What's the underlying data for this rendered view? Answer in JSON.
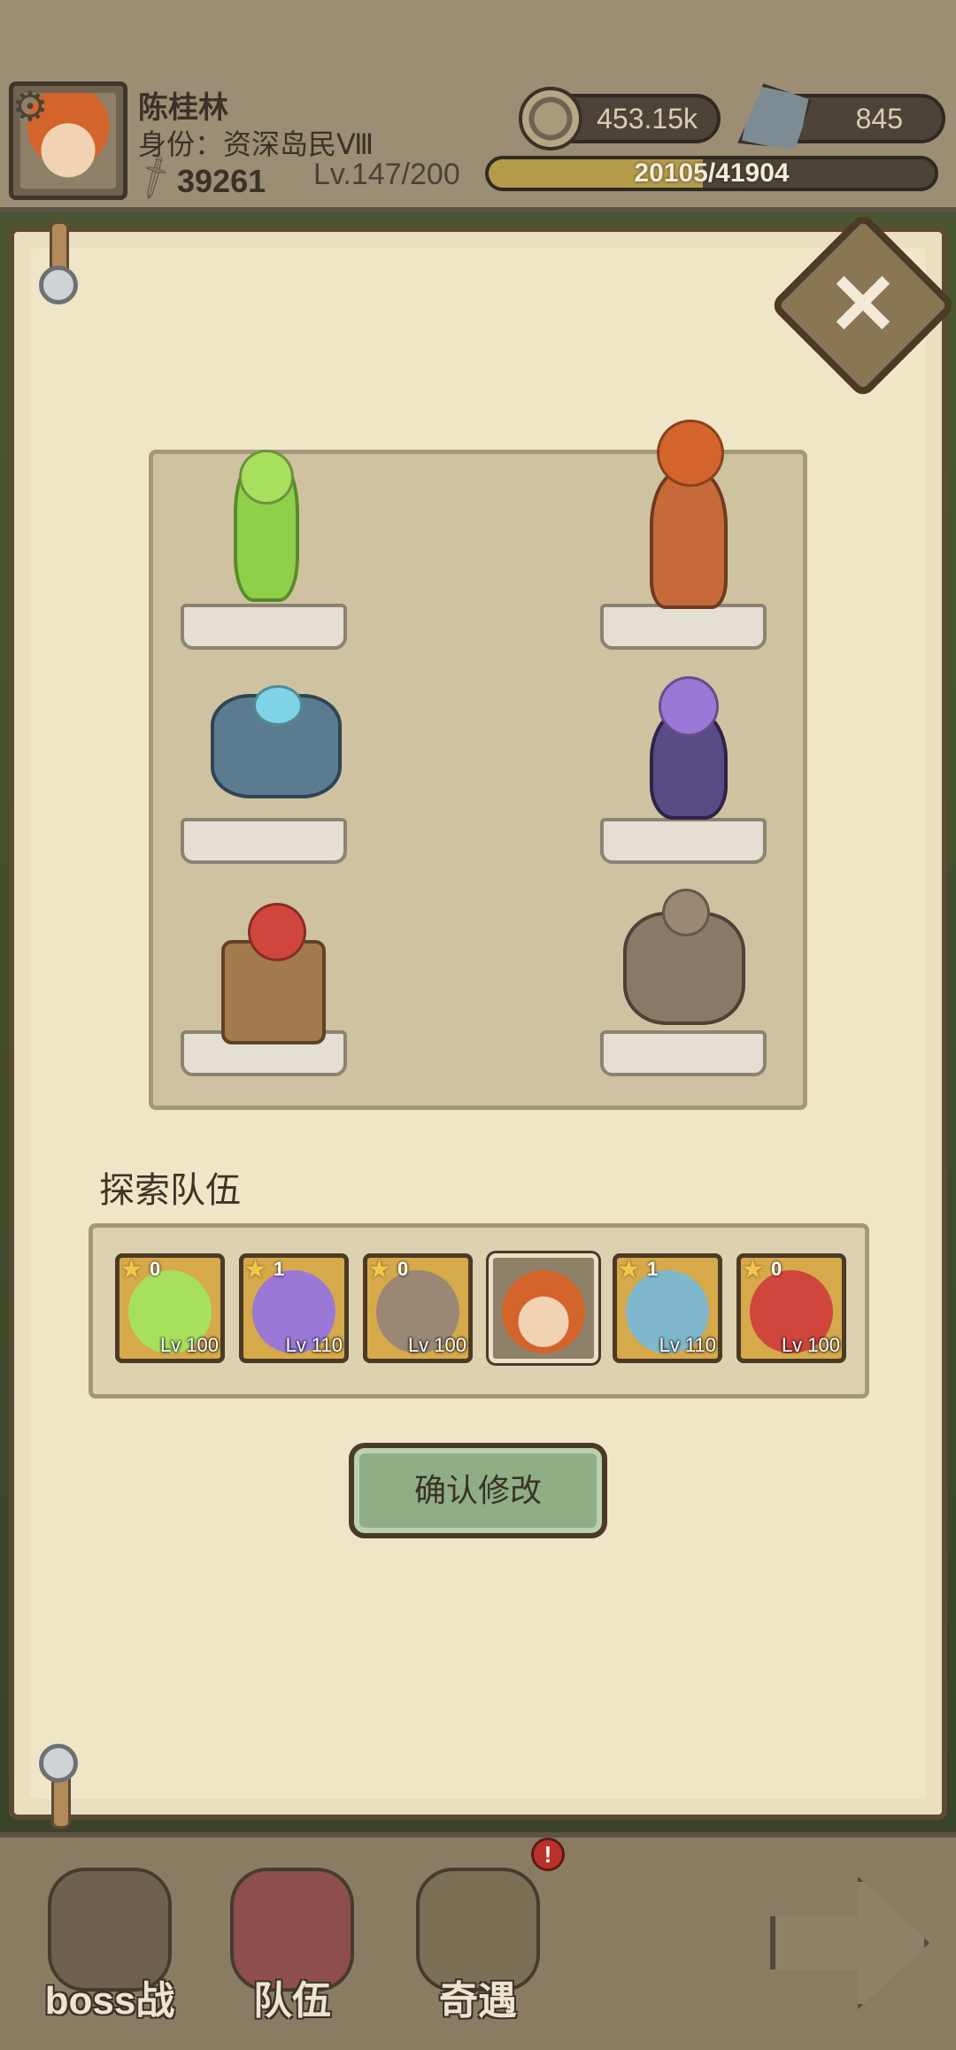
{
  "header": {
    "player_name": "陈桂林",
    "player_rank": "身份：资深岛民Ⅷ",
    "combat_power": "39261",
    "level": "Lv.147/200",
    "coins": "453.15k",
    "gems": "845",
    "exp_text": "20105/41904",
    "exp_fraction": 0.48,
    "icons": [
      "gear-icon",
      "sword-icon",
      "coin-icon",
      "gem-icon"
    ]
  },
  "panel": {
    "close_icon": "close-icon",
    "close_glyph": "✕",
    "formation": [
      {
        "slot": "left-1",
        "figure": "green-slime-girl"
      },
      {
        "slot": "right-1",
        "figure": "red-haired-swordsman"
      },
      {
        "slot": "left-2",
        "figure": "crystal-golem"
      },
      {
        "slot": "right-2",
        "figure": "purple-ghost-girl"
      },
      {
        "slot": "left-3",
        "figure": "mimic-chest-girl"
      },
      {
        "slot": "right-3",
        "figure": "rock-golem"
      }
    ],
    "team_title": "探索队伍",
    "team": [
      {
        "count": "0",
        "level": "Lv 100",
        "portrait": "green-slime-girl"
      },
      {
        "count": "1",
        "level": "Lv 110",
        "portrait": "purple-ghost-girl"
      },
      {
        "count": "0",
        "level": "Lv 100",
        "portrait": "rock-golem"
      },
      {
        "count": "",
        "level": "",
        "portrait": "red-haired-swordsman"
      },
      {
        "count": "1",
        "level": "Lv 110",
        "portrait": "crystal-golem"
      },
      {
        "count": "0",
        "level": "Lv 100",
        "portrait": "mimic-chest-girl"
      }
    ],
    "confirm_label": "确认修改"
  },
  "bottom_nav": {
    "items": [
      {
        "label": "boss战",
        "icon": "skull-icon"
      },
      {
        "label": "队伍",
        "icon": "flag-icon"
      },
      {
        "label": "奇遇",
        "icon": "treasure-bag-icon"
      }
    ],
    "badge": "!",
    "back_icon": "back-arrow-icon"
  },
  "colors": {
    "parchment": "#efe6c8",
    "frame": "#5e4a33",
    "confirm_green": "#8fae86",
    "exp_fill": "#b49c4a"
  }
}
